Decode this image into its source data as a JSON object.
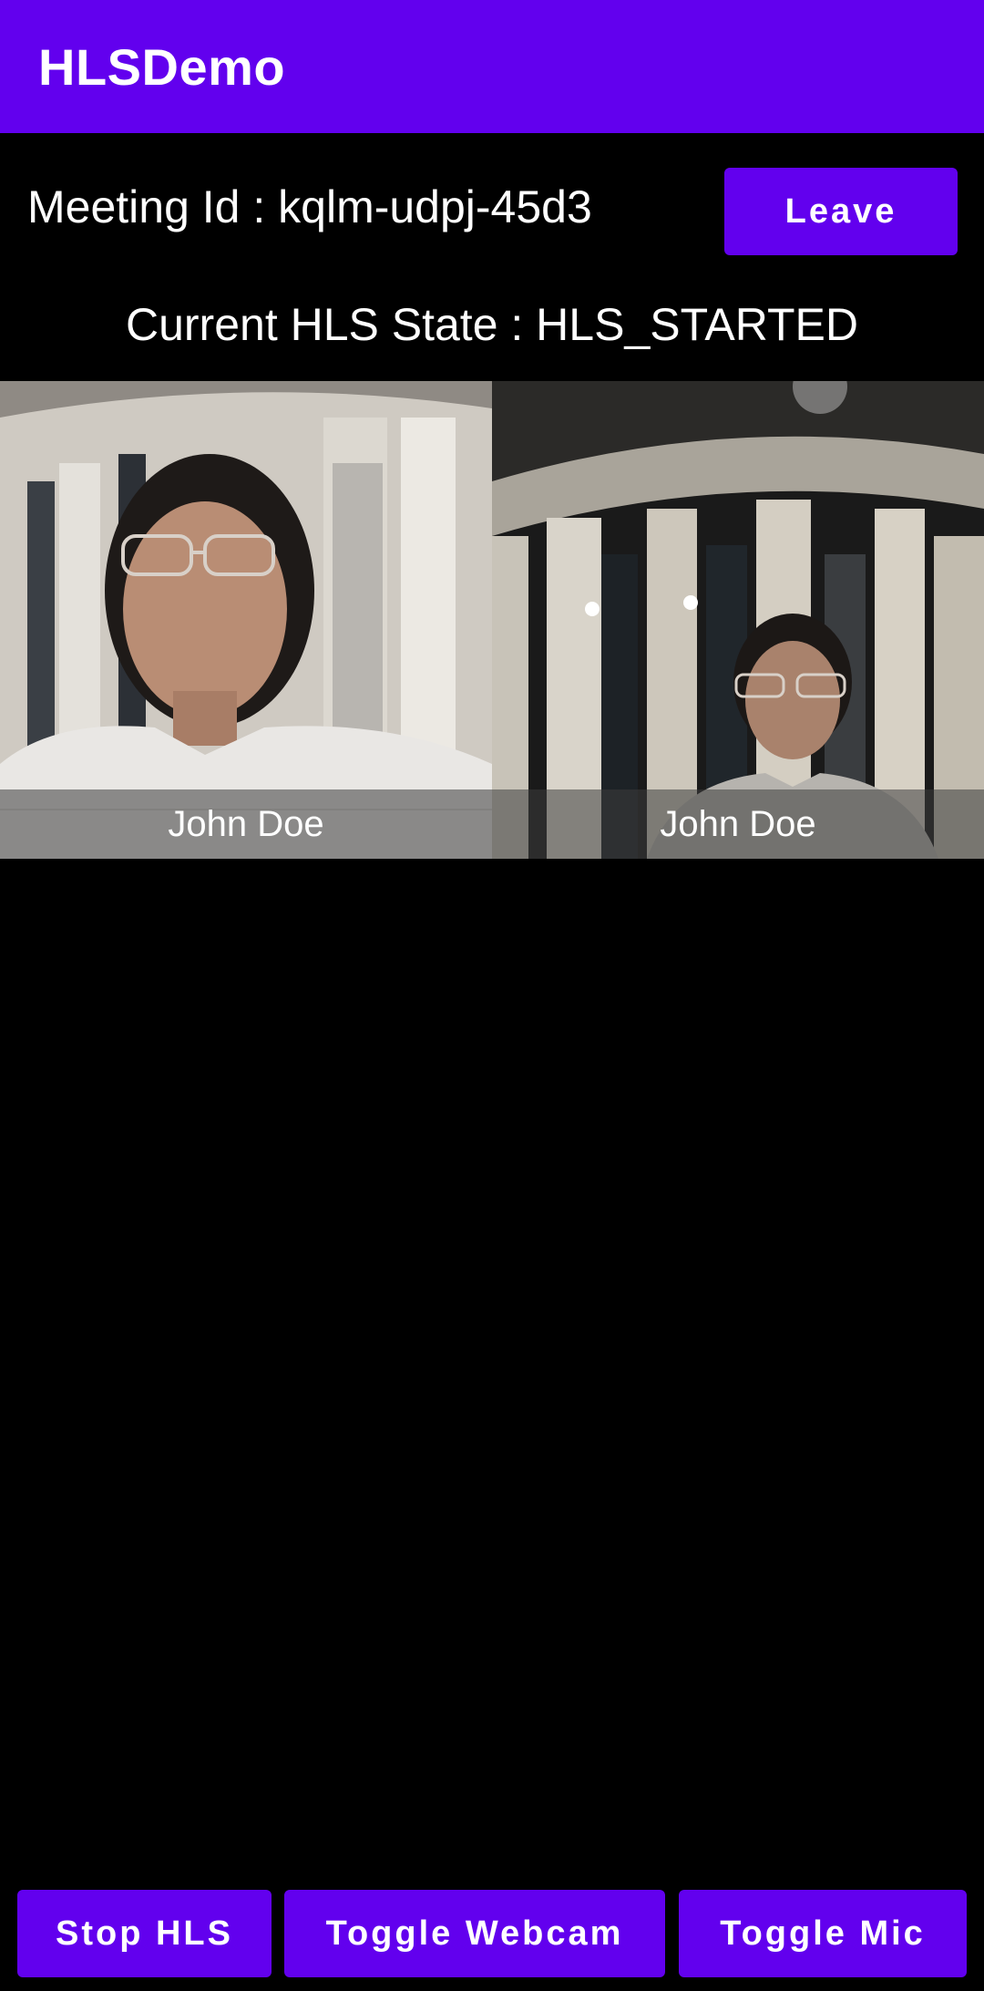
{
  "app_bar": {
    "title": "HLSDemo"
  },
  "meeting": {
    "id_text": "Meeting Id : kqlm-udpj-45d3",
    "leave_label": "Leave"
  },
  "hls": {
    "state_text": "Current HLS State : HLS_STARTED"
  },
  "participants": [
    {
      "name": "John Doe"
    },
    {
      "name": "John Doe"
    }
  ],
  "controls": {
    "stop_hls_label": "Stop HLS",
    "toggle_webcam_label": "Toggle Webcam",
    "toggle_mic_label": "Toggle Mic"
  },
  "colors": {
    "primary": "#6200EE",
    "background": "#000000",
    "text": "#FFFFFF"
  }
}
